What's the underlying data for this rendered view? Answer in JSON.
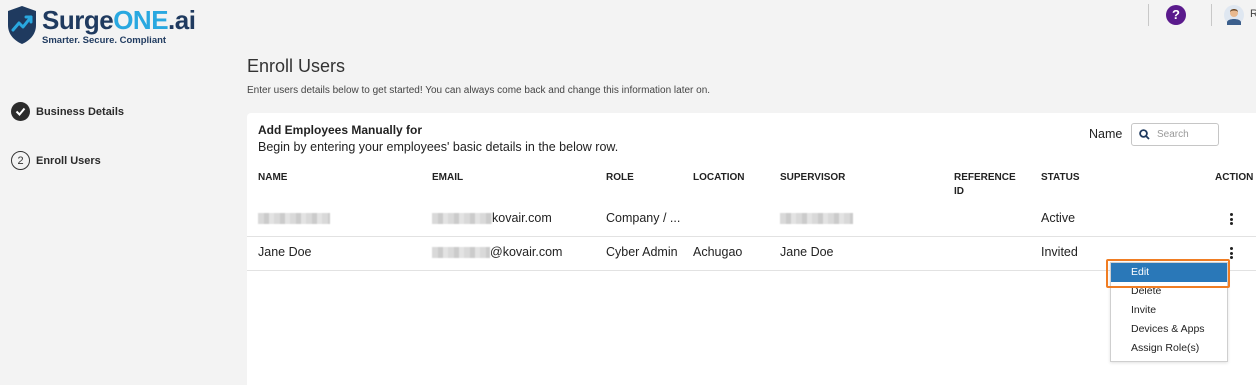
{
  "brand": {
    "name_part1": "Surge",
    "name_part2": "ONE",
    "name_part3": ".ai",
    "tagline": "Smarter. Secure. Compliant",
    "primary_color": "#1f3a5f",
    "accent_color": "#29a8e0"
  },
  "header": {
    "help_label": "?",
    "user_initial": "R",
    "help_color": "#5a1a8c"
  },
  "steps": [
    {
      "label": "Business Details",
      "status": "done",
      "icon": "check-icon"
    },
    {
      "number": "2",
      "label": "Enroll Users",
      "status": "active"
    }
  ],
  "page": {
    "title": "Enroll Users",
    "subtitle": "Enter users details below to get started! You can always come back and change this information later on."
  },
  "card": {
    "title": "Add Employees Manually for",
    "description": "Begin by entering your employees' basic details in the below row.",
    "search_label": "Name",
    "search_placeholder": "Search"
  },
  "table": {
    "columns": [
      "NAME",
      "EMAIL",
      "ROLE",
      "LOCATION",
      "SUPERVISOR",
      "REFERENCE ID",
      "STATUS",
      "ACTION"
    ],
    "rows": [
      {
        "name": "",
        "email": "kovair.com",
        "role": "Company / ...",
        "location": "",
        "supervisor": "",
        "reference_id": "",
        "status": "Active"
      },
      {
        "name": "Jane Doe",
        "email": "@kovair.com",
        "role": "Cyber Admin",
        "location": "Achugao",
        "supervisor": "Jane Doe",
        "reference_id": "",
        "status": "Invited"
      }
    ]
  },
  "action_menu": {
    "items": [
      "Edit",
      "Delete",
      "Invite",
      "Devices & Apps",
      "Assign Role(s)"
    ],
    "active_index": 0,
    "highlight_color": "#f07d23",
    "active_color": "#2a78b8"
  }
}
